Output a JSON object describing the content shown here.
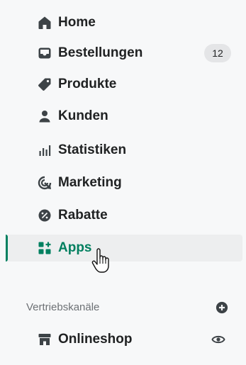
{
  "nav": {
    "items": [
      {
        "label": "Home",
        "icon": "home-icon"
      },
      {
        "label": "Bestellungen",
        "icon": "inbox-icon",
        "badge": "12"
      },
      {
        "label": "Produkte",
        "icon": "tag-icon"
      },
      {
        "label": "Kunden",
        "icon": "person-icon"
      },
      {
        "label": "Statistiken",
        "icon": "bar-chart-icon"
      },
      {
        "label": "Marketing",
        "icon": "target-icon"
      },
      {
        "label": "Rabatte",
        "icon": "discount-icon"
      },
      {
        "label": "Apps",
        "icon": "apps-icon",
        "active": true
      }
    ]
  },
  "sales_channels": {
    "title": "Vertriebskanäle",
    "add_icon": "plus-circle-icon",
    "items": [
      {
        "label": "Onlineshop",
        "icon": "store-icon",
        "action_icon": "eye-icon"
      }
    ]
  },
  "colors": {
    "accent": "#008060",
    "text": "#202223",
    "muted": "#6d7175",
    "background": "#f7f8f9",
    "active_bg": "#edeeef"
  },
  "cursor_icon": "hand-pointer-icon"
}
